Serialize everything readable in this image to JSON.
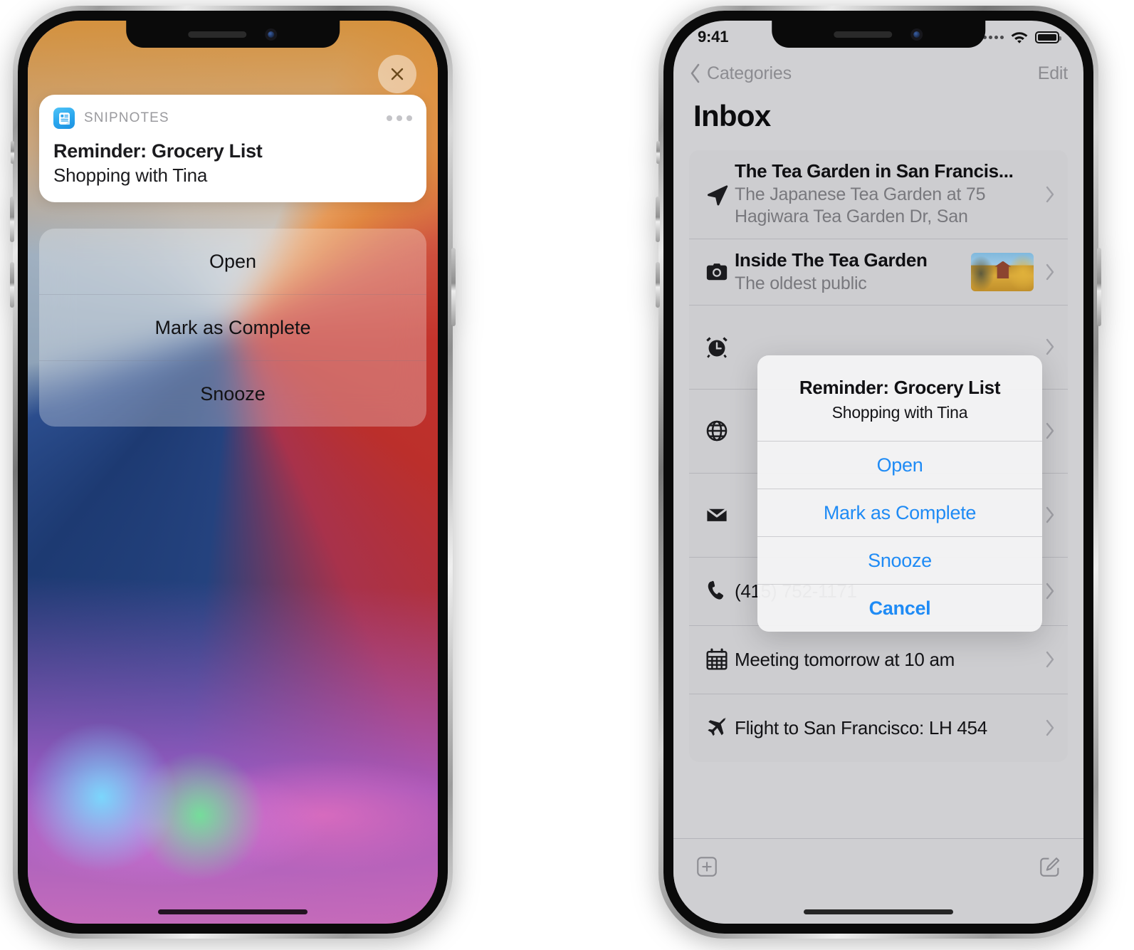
{
  "left_phone": {
    "close_button": {
      "icon": "close-icon",
      "label": "Close"
    },
    "notification": {
      "app_icon": "snipnotes-app-icon",
      "app_name": "SNIPNOTES",
      "more_icon": "more-options-icon",
      "title": "Reminder: Grocery List",
      "subtitle": "Shopping with Tina"
    },
    "actions": [
      {
        "label": "Open"
      },
      {
        "label": "Mark as Complete"
      },
      {
        "label": "Snooze"
      }
    ]
  },
  "right_phone": {
    "statusbar": {
      "time": "9:41",
      "signal_icon": "cellular-signal-icon",
      "wifi_icon": "wifi-icon",
      "battery_icon": "battery-full-icon"
    },
    "navbar": {
      "back_icon": "chevron-left-icon",
      "back_label": "Categories",
      "edit_label": "Edit"
    },
    "page_title": "Inbox",
    "list": [
      {
        "icon": "location-arrow-icon",
        "title": "The Tea Garden in San Francis...",
        "subtitle": "The Japanese Tea Garden at 75 Hagiwara Tea Garden Dr, San",
        "has_thumbnail": false,
        "chevron": "chevron-right-icon"
      },
      {
        "icon": "camera-icon",
        "title": "Inside The Tea Garden",
        "subtitle": "The oldest public",
        "has_thumbnail": true,
        "thumbnail": "japanese-pagoda-photo",
        "chevron": "chevron-right-icon"
      },
      {
        "icon": "alarm-clock-icon",
        "title": "",
        "subtitle": "",
        "has_thumbnail": false,
        "chevron": "chevron-right-icon"
      },
      {
        "icon": "globe-icon",
        "title": "",
        "subtitle": "",
        "has_thumbnail": false,
        "chevron": "chevron-right-icon"
      },
      {
        "icon": "mail-icon",
        "title": "",
        "subtitle": "",
        "has_thumbnail": false,
        "chevron": "chevron-right-icon"
      },
      {
        "icon": "phone-icon",
        "title": "(415) 752-1171",
        "single_line": true,
        "chevron": "chevron-right-icon"
      },
      {
        "icon": "calendar-icon",
        "title": "Meeting tomorrow at 10 am",
        "single_line": true,
        "chevron": "chevron-right-icon"
      },
      {
        "icon": "airplane-icon",
        "title": "Flight to San Francisco: LH 454",
        "single_line": true,
        "chevron": "chevron-right-icon"
      }
    ],
    "alert": {
      "title": "Reminder: Grocery List",
      "message": "Shopping with Tina",
      "buttons": [
        {
          "label": "Open",
          "bold": false
        },
        {
          "label": "Mark as Complete",
          "bold": false
        },
        {
          "label": "Snooze",
          "bold": false
        },
        {
          "label": "Cancel",
          "bold": true
        }
      ]
    },
    "toolbar": {
      "add_icon": "add-note-icon",
      "compose_icon": "compose-icon"
    }
  },
  "colors": {
    "ios_blue": "#1f8bf5",
    "app_icon_blue": "#29a6ee",
    "screen_bg": "#d0d0d3"
  }
}
